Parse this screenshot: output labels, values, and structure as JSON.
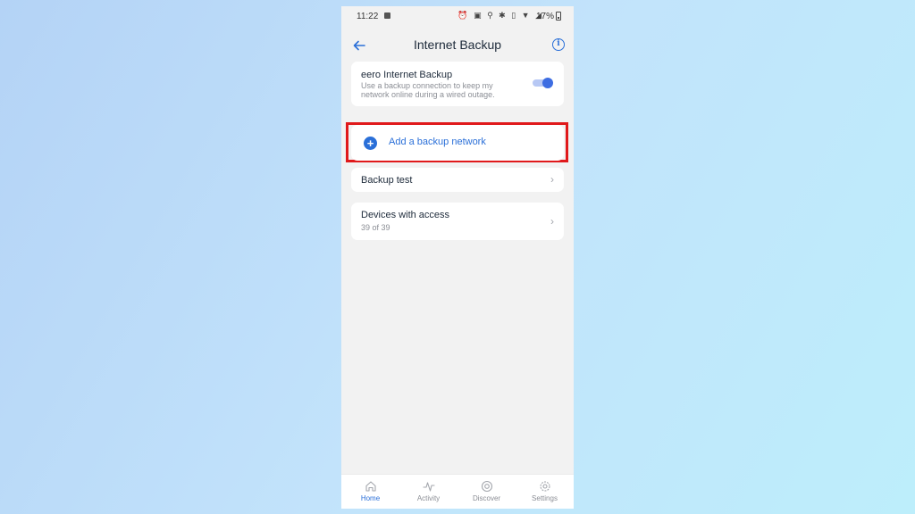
{
  "status_bar": {
    "time": "11:22",
    "icons": "⏰ ▣ ⚲ ✱ ▯ ▼ ◢",
    "battery": "17%"
  },
  "header": {
    "title": "Internet Backup"
  },
  "backup_card": {
    "title": "eero Internet Backup",
    "description": "Use a backup connection to keep my network online during a wired outage.",
    "enabled": true
  },
  "add_backup": {
    "label": "Add a backup network"
  },
  "backup_test": {
    "label": "Backup test"
  },
  "devices": {
    "label": "Devices with access",
    "count": "39 of 39"
  },
  "nav": {
    "items": [
      {
        "label": "Home",
        "icon": "home-icon",
        "active": true
      },
      {
        "label": "Activity",
        "icon": "activity-icon",
        "active": false
      },
      {
        "label": "Discover",
        "icon": "discover-icon",
        "active": false
      },
      {
        "label": "Settings",
        "icon": "settings-icon",
        "active": false
      }
    ]
  },
  "colors": {
    "accent": "#2a6fd8",
    "highlight": "#e0191b",
    "toggle_on": "#3d6de2"
  }
}
